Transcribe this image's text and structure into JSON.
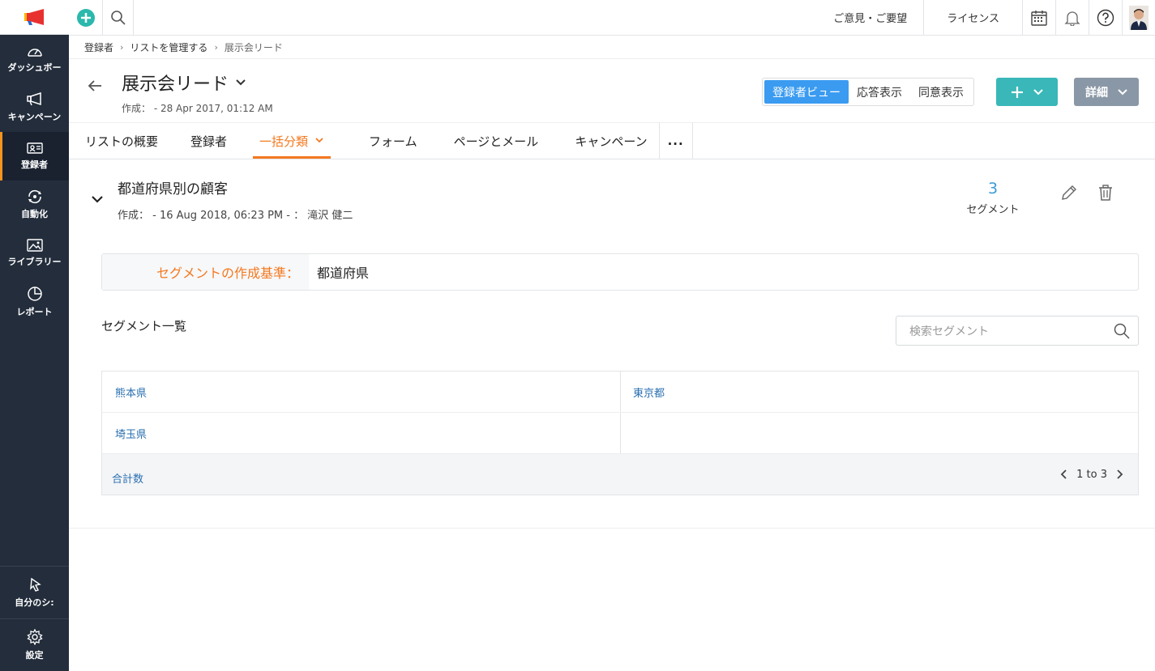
{
  "sidebar": {
    "items": [
      {
        "label": "ダッシュボー",
        "icon": "gauge-icon"
      },
      {
        "label": "キャンペーン",
        "icon": "megaphone-icon"
      },
      {
        "label": "登録者",
        "icon": "contact-card-icon",
        "active": true
      },
      {
        "label": "自動化",
        "icon": "automation-icon"
      },
      {
        "label": "ライブラリー",
        "icon": "image-icon"
      },
      {
        "label": "レポート",
        "icon": "pie-chart-icon"
      }
    ],
    "bottom": [
      {
        "label": "自分のシ:",
        "icon": "pointer-icon"
      },
      {
        "label": "設定",
        "icon": "gear-icon"
      }
    ]
  },
  "topbar": {
    "feedback": "ご意見・ご要望",
    "license": "ライセンス"
  },
  "breadcrumb": [
    "登録者",
    "リストを管理する",
    "展示会リード"
  ],
  "header": {
    "title": "展示会リード",
    "created": "作成： - 28 Apr 2017, 01:12 AM",
    "views": [
      "登録者ビュー",
      "応答表示",
      "同意表示"
    ],
    "detail_label": "詳細"
  },
  "tabs": [
    "リストの概要",
    "登録者",
    "一括分類",
    "フォーム",
    "ページとメール",
    "キャンペーン",
    "..."
  ],
  "segment": {
    "title": "都道府県別の顧客",
    "created": "作成： - 16 Aug 2018, 06:23 PM - ： 滝沢 健二",
    "count": "3",
    "count_label": "セグメント",
    "criteria_label": "セグメントの作成基準：",
    "criteria_value": "都道府県"
  },
  "segment_list": {
    "title": "セグメント一覧",
    "search_placeholder": "検索セグメント",
    "rows": [
      [
        "熊本県",
        "東京都"
      ],
      [
        "埼玉県",
        ""
      ]
    ],
    "total_label": "合計数",
    "pager": "1 to 3"
  },
  "colors": {
    "sidebar_bg": "#232d3b",
    "accent_orange": "#f47920",
    "primary_blue": "#3a9bf0",
    "teal": "#3ab7b8",
    "link_blue": "#2a6fb0"
  }
}
